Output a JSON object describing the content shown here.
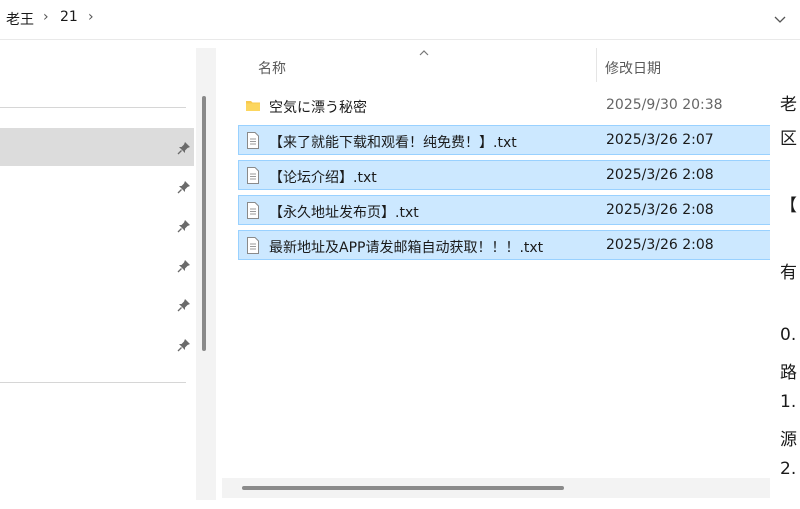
{
  "breadcrumb": {
    "items": [
      "老王",
      "21"
    ],
    "separator": "›"
  },
  "columns": {
    "name": "名称",
    "modified": "修改日期"
  },
  "files": [
    {
      "name": "空気に漂う秘密",
      "date": "2025/9/30 20:38",
      "type": "folder",
      "selected": false
    },
    {
      "name": "【来了就能下载和观看！纯免费！】.txt",
      "date": "2025/3/26 2:07",
      "type": "txt",
      "selected": true
    },
    {
      "name": "【论坛介绍】.txt",
      "date": "2025/3/26 2:08",
      "type": "txt",
      "selected": true
    },
    {
      "name": "【永久地址发布页】.txt",
      "date": "2025/3/26 2:08",
      "type": "txt",
      "selected": true
    },
    {
      "name": "最新地址及APP请发邮箱自动获取！！！.txt",
      "date": "2025/3/26 2:08",
      "type": "txt",
      "selected": true
    }
  ],
  "preview_lines": [
    "老",
    "区",
    "【",
    "有",
    "0.",
    "路",
    "1.",
    "源",
    "2."
  ],
  "colors": {
    "selection_fill": "#cce8ff",
    "selection_border": "#99d1ff",
    "folder": "#f8c94e",
    "nav_selected": "#dcdcdc"
  },
  "icons": {
    "expand": "chevron-down-icon",
    "pin": "pin-icon",
    "folder": "folder-icon",
    "file": "text-file-icon",
    "sort": "sort-caret-icon"
  }
}
